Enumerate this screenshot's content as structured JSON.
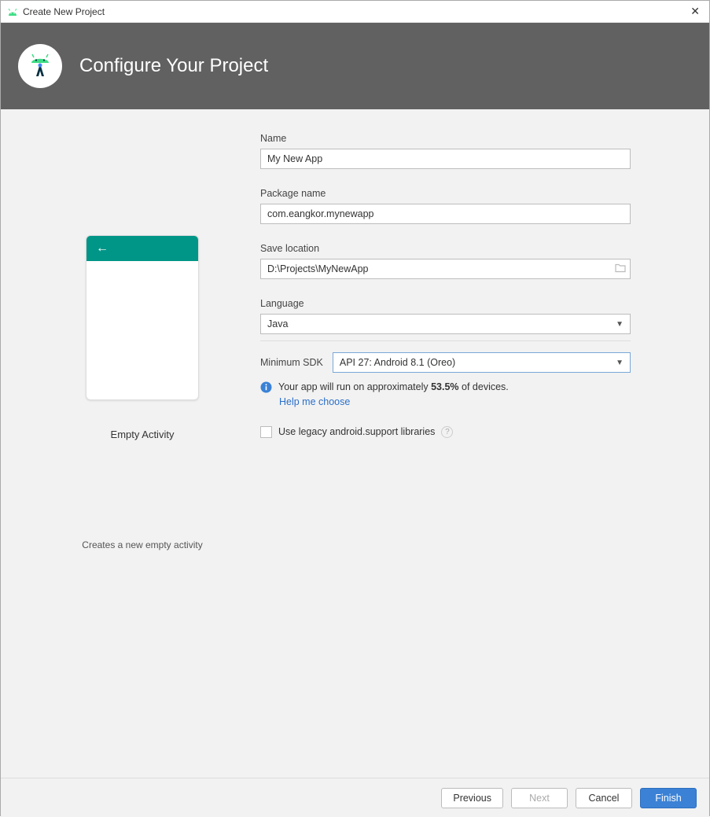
{
  "window": {
    "title": "Create New Project"
  },
  "header": {
    "title": "Configure Your Project"
  },
  "preview": {
    "label": "Empty Activity",
    "description": "Creates a new empty activity"
  },
  "form": {
    "name": {
      "label": "Name",
      "value": "My New App"
    },
    "package": {
      "label": "Package name",
      "value": "com.eangkor.mynewapp"
    },
    "location": {
      "label": "Save location",
      "value": "D:\\Projects\\MyNewApp"
    },
    "language": {
      "label": "Language",
      "value": "Java"
    },
    "min_sdk": {
      "label": "Minimum SDK",
      "value": "API 27: Android 8.1 (Oreo)"
    },
    "info": {
      "prefix": "Your app will run on approximately ",
      "percent": "53.5%",
      "suffix": " of devices."
    },
    "help_link": "Help me choose",
    "legacy_checkbox": {
      "label": "Use legacy android.support libraries",
      "checked": false
    }
  },
  "footer": {
    "previous": "Previous",
    "next": "Next",
    "cancel": "Cancel",
    "finish": "Finish"
  }
}
